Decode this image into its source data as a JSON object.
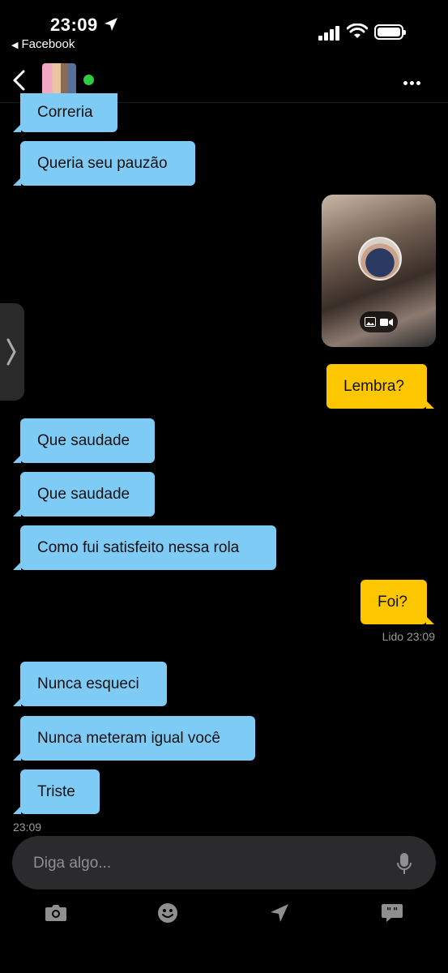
{
  "status": {
    "time": "23:09",
    "back_app": "Facebook"
  },
  "icons": {
    "location": "location-arrow-icon",
    "signal": "cellular-signal-icon",
    "wifi": "wifi-icon",
    "battery": "battery-icon",
    "back": "chevron-left-icon",
    "more": "more-horizontal-icon",
    "mic": "microphone-icon",
    "camera": "camera-icon",
    "emoji": "smiley-icon",
    "send_location": "location-arrow-icon",
    "quick_replies": "quick-reply-bubbles-icon",
    "photo": "photo-icon",
    "video": "video-icon"
  },
  "colors": {
    "incoming": "#7ecbf5",
    "outgoing": "#fdc700",
    "online": "#2ecc40",
    "composer": "#2b2b2d"
  },
  "messages": [
    {
      "dir": "in",
      "text": "Correria"
    },
    {
      "dir": "in",
      "text": "Queria seu pauzão"
    },
    {
      "dir": "out",
      "type": "media"
    },
    {
      "dir": "out",
      "text": "Lembra?"
    },
    {
      "dir": "in",
      "text": "Que saudade"
    },
    {
      "dir": "in",
      "text": "Que saudade"
    },
    {
      "dir": "in",
      "text": "Como fui satisfeito nessa rola"
    },
    {
      "dir": "out",
      "text": "Foi?"
    },
    {
      "dir": "in",
      "text": "Nunca esqueci"
    },
    {
      "dir": "in",
      "text": "Nunca meteram igual você"
    },
    {
      "dir": "in",
      "text": "Triste"
    }
  ],
  "read_receipt": "Lido 23:09",
  "last_timestamp": "23:09",
  "composer": {
    "placeholder": "Diga algo...",
    "value": ""
  }
}
